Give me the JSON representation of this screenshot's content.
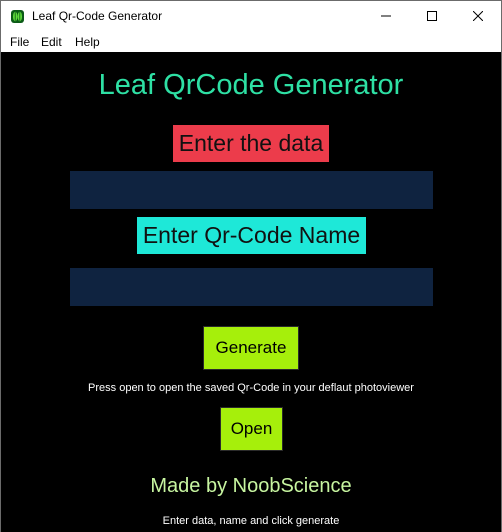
{
  "window": {
    "title": "Leaf Qr-Code Generator",
    "app_icon": "leaf-icon",
    "controls": [
      "minimize-icon",
      "maximize-icon",
      "close-icon"
    ]
  },
  "menu": {
    "file": "File",
    "edit": "Edit",
    "help": "Help"
  },
  "main": {
    "heading": "Leaf QrCode Generator",
    "data_label": "Enter the data",
    "data_value": "",
    "name_label": "Enter Qr-Code Name",
    "name_value": "",
    "generate_label": "Generate",
    "open_hint": "Press open to open the saved Qr-Code in your deflaut photoviewer",
    "open_label": "Open",
    "credit": "Made by NoobScience",
    "status": "Enter data, name and click generate"
  },
  "colors": {
    "background": "#000000",
    "heading": "#2ee0a4",
    "data_label_bg": "#ec3c4b",
    "name_label_bg": "#1ee8d8",
    "input_bg": "#0f2340",
    "button_bg": "#a6ef0b",
    "credit": "#c7f5a0"
  }
}
